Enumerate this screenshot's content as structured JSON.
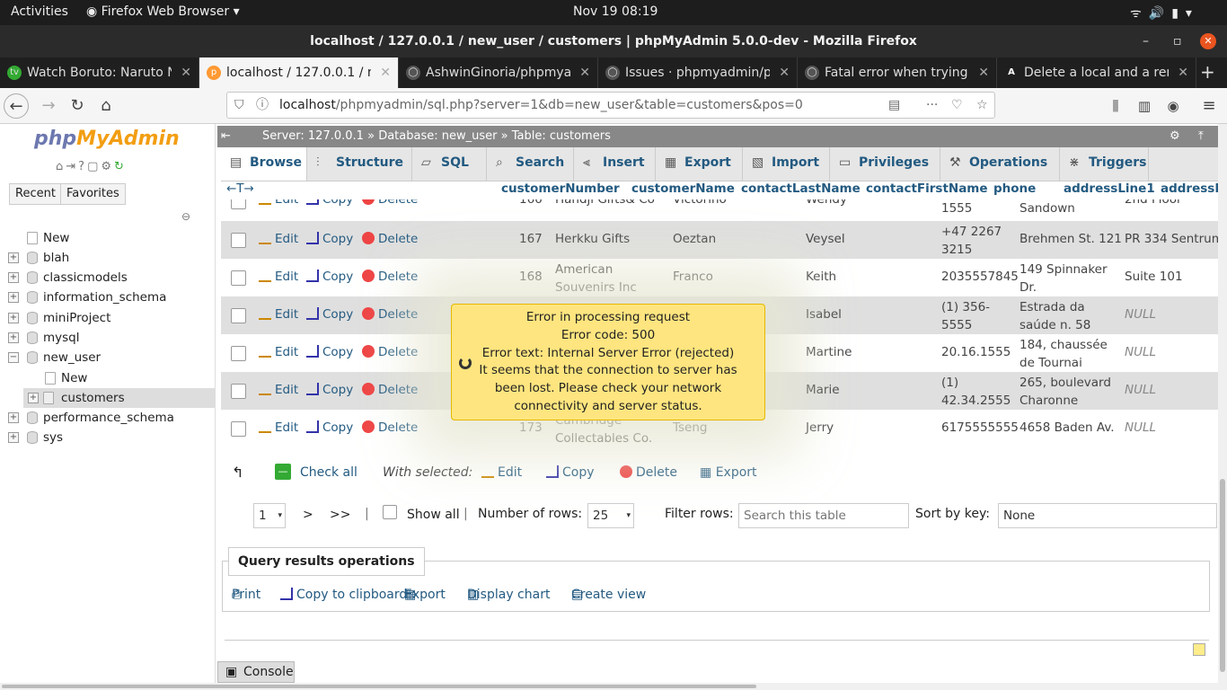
{
  "system": {
    "activities": "Activities",
    "app": "Firefox Web Browser",
    "clock": "Nov 19  08:19"
  },
  "window": {
    "title": "localhost / 127.0.0.1 / new_user / customers | phpMyAdmin 5.0.0-dev - Mozilla Firefox"
  },
  "tabs": [
    {
      "label": "Watch Boruto: Naruto N"
    },
    {
      "label": "localhost / 127.0.0.1 / ne"
    },
    {
      "label": "AshwinGinoria/phpmya"
    },
    {
      "label": "Issues · phpmyadmin/ph"
    },
    {
      "label": "Fatal error when trying t"
    },
    {
      "label": "Delete a local and a rem"
    }
  ],
  "url": {
    "host": "localhost",
    "path": "/phpmyadmin/sql.php?server=1&db=new_user&table=customers&pos=0"
  },
  "sidebar": {
    "logo_a": "php",
    "logo_b": "MyAdmin",
    "recent": "Recent",
    "favorites": "Favorites",
    "tree": [
      "New",
      "blah",
      "classicmodels",
      "information_schema",
      "miniProject",
      "mysql",
      "new_user",
      "New",
      "customers",
      "performance_schema",
      "sys"
    ]
  },
  "breadcrumb": {
    "server": "Server: 127.0.0.1",
    "database": "Database: new_user",
    "table": "Table: customers",
    "sep": "»"
  },
  "ptabs": [
    "Browse",
    "Structure",
    "SQL",
    "Search",
    "Insert",
    "Export",
    "Import",
    "Privileges",
    "Operations",
    "Triggers"
  ],
  "columns": [
    "customerNumber",
    "customerName",
    "contactLastName",
    "contactFirstName",
    "phone",
    "addressLine1",
    "addressLi"
  ],
  "actions": {
    "edit": "Edit",
    "copy": "Copy",
    "delete": "Delete"
  },
  "rows": [
    {
      "num": "166",
      "name": "Handji Gifts& Co",
      "last": "Victorino",
      "first": "Wendy",
      "phone": "1555",
      "addr1": "Sandown",
      "addr2": "2nd Floor"
    },
    {
      "num": "167",
      "name": "Herkku Gifts",
      "last": "Oeztan",
      "first": "Veysel",
      "phone": "+47 2267 3215",
      "addr1": "Brehmen St. 121",
      "addr2": "PR 334 Sentrum"
    },
    {
      "num": "168",
      "name": "American Souvenirs Inc",
      "last": "Franco",
      "first": "Keith",
      "phone": "2035557845",
      "addr1": "149 Spinnaker Dr.",
      "addr2": "Suite 101"
    },
    {
      "num": "",
      "name": "",
      "last": "",
      "first": "Isabel",
      "phone": "(1) 356-5555",
      "addr1": "Estrada da saúde n. 58",
      "addr2": "NULL"
    },
    {
      "num": "",
      "name": "",
      "last": "",
      "first": "Martine",
      "phone": "20.16.1555",
      "addr1": "184, chaussée de Tournai",
      "addr2": "NULL"
    },
    {
      "num": "",
      "name": "",
      "last": "",
      "first": "Marie",
      "phone": "(1) 42.34.2555",
      "addr1": "265, boulevard Charonne",
      "addr2": "NULL"
    },
    {
      "num": "173",
      "name": "Cambridge Collectables Co.",
      "last": "Tseng",
      "first": "Jerry",
      "phone": "6175555555",
      "addr1": "4658 Baden Av.",
      "addr2": "NULL"
    }
  ],
  "error": {
    "line1": "Error in processing request",
    "line2": "Error code: 500",
    "line3": "Error text: Internal Server Error (rejected)",
    "line4": "It seems that the connection to server has been lost. Please check your network connectivity and server status."
  },
  "bulk": {
    "check_all": "Check all",
    "with_selected": "With selected:",
    "edit": "Edit",
    "copy": "Copy",
    "delete": "Delete",
    "export": "Export"
  },
  "pager": {
    "page": "1",
    "next": ">",
    "last": ">>",
    "show_all": "Show all",
    "rows_label": "Number of rows:",
    "rows": "25",
    "filter_label": "Filter rows:",
    "filter_placeholder": "Search this table",
    "sort_label": "Sort by key:",
    "sort_value": "None"
  },
  "qro": {
    "title": "Query results operations",
    "print": "Print",
    "clipboard": "Copy to clipboard",
    "export": "Export",
    "chart": "Display chart",
    "view": "Create view"
  },
  "console": "Console"
}
